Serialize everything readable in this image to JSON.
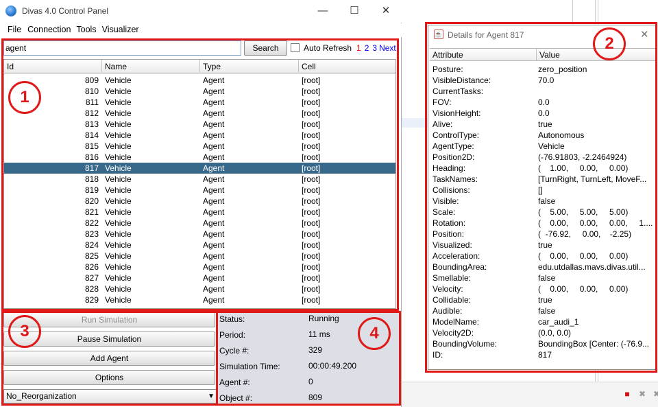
{
  "main_window": {
    "title": "Divas 4.0 Control Panel",
    "controls": {
      "minimize": "—",
      "maximize": "☐",
      "close": "✕"
    }
  },
  "menu": [
    "File",
    "Connection",
    "Tools",
    "Visualizer"
  ],
  "search": {
    "value": "agent",
    "button": "Search",
    "auto_refresh_label": "Auto Refresh",
    "auto_refresh_checked": false
  },
  "pagination": {
    "current": "1",
    "pages": [
      "2",
      "3"
    ],
    "next": "Next"
  },
  "table": {
    "columns": [
      "Id",
      "Name",
      "Type",
      "Cell"
    ],
    "rows": [
      [
        "809",
        "Vehicle",
        "Agent",
        "[root]"
      ],
      [
        "810",
        "Vehicle",
        "Agent",
        "[root]"
      ],
      [
        "811",
        "Vehicle",
        "Agent",
        "[root]"
      ],
      [
        "812",
        "Vehicle",
        "Agent",
        "[root]"
      ],
      [
        "813",
        "Vehicle",
        "Agent",
        "[root]"
      ],
      [
        "814",
        "Vehicle",
        "Agent",
        "[root]"
      ],
      [
        "815",
        "Vehicle",
        "Agent",
        "[root]"
      ],
      [
        "816",
        "Vehicle",
        "Agent",
        "[root]"
      ],
      [
        "817",
        "Vehicle",
        "Agent",
        "[root]"
      ],
      [
        "818",
        "Vehicle",
        "Agent",
        "[root]"
      ],
      [
        "819",
        "Vehicle",
        "Agent",
        "[root]"
      ],
      [
        "820",
        "Vehicle",
        "Agent",
        "[root]"
      ],
      [
        "821",
        "Vehicle",
        "Agent",
        "[root]"
      ],
      [
        "822",
        "Vehicle",
        "Agent",
        "[root]"
      ],
      [
        "823",
        "Vehicle",
        "Agent",
        "[root]"
      ],
      [
        "824",
        "Vehicle",
        "Agent",
        "[root]"
      ],
      [
        "825",
        "Vehicle",
        "Agent",
        "[root]"
      ],
      [
        "826",
        "Vehicle",
        "Agent",
        "[root]"
      ],
      [
        "827",
        "Vehicle",
        "Agent",
        "[root]"
      ],
      [
        "828",
        "Vehicle",
        "Agent",
        "[root]"
      ],
      [
        "829",
        "Vehicle",
        "Agent",
        "[root]"
      ]
    ],
    "selected_id": "817",
    "selected_color": "#39698a"
  },
  "controls": {
    "run": "Run Simulation",
    "pause": "Pause Simulation",
    "add_agent": "Add Agent",
    "options": "Options",
    "reorganization": "No_Reorganization"
  },
  "status": {
    "rows": [
      {
        "label": "Status:",
        "value": "Running"
      },
      {
        "label": "Period:",
        "value": "11 ms"
      },
      {
        "label": "Cycle #:",
        "value": "329"
      },
      {
        "label": "Simulation Time:",
        "value": "00:00:49.200"
      },
      {
        "label": "Agent #:",
        "value": "0"
      },
      {
        "label": "Object #:",
        "value": "809"
      }
    ]
  },
  "details": {
    "title": "Details for Agent 817",
    "columns": [
      "Attribute",
      "Value"
    ],
    "rows": [
      [
        "Posture:",
        "zero_position"
      ],
      [
        "VisibleDistance:",
        "70.0"
      ],
      [
        "CurrentTasks:",
        ""
      ],
      [
        "FOV:",
        "0.0"
      ],
      [
        "VisionHeight:",
        "0.0"
      ],
      [
        "Alive:",
        "true"
      ],
      [
        "ControlType:",
        "Autonomous"
      ],
      [
        "AgentType:",
        "Vehicle"
      ],
      [
        "Position2D:",
        "(-76.91803, -2.2464924)"
      ],
      [
        "Heading:",
        "(    1.00,     0.00,     0.00)"
      ],
      [
        "TaskNames:",
        "[TurnRight, TurnLeft, MoveF..."
      ],
      [
        "Collisions:",
        "[]"
      ],
      [
        "Visible:",
        "false"
      ],
      [
        "Scale:",
        "(    5.00,     5.00,     5.00)"
      ],
      [
        "Rotation:",
        "(    0.00,     0.00,     0.00,     1...."
      ],
      [
        "Position:",
        "(  -76.92,     0.00,    -2.25)"
      ],
      [
        "Visualized:",
        "true"
      ],
      [
        "Acceleration:",
        "(    0.00,     0.00,     0.00)"
      ],
      [
        "BoundingArea:",
        "edu.utdallas.mavs.divas.util..."
      ],
      [
        "Smellable:",
        "false"
      ],
      [
        "Velocity:",
        "(    0.00,     0.00,     0.00)"
      ],
      [
        "Collidable:",
        "true"
      ],
      [
        "Audible:",
        "false"
      ],
      [
        "ModelName:",
        "car_audi_1"
      ],
      [
        "Velocity2D:",
        "(0.0, 0.0)"
      ],
      [
        "BoundingVolume:",
        "BoundingBox [Center: (-76.9..."
      ],
      [
        "ID:",
        "817"
      ]
    ]
  },
  "annotations": {
    "color": "#e01919",
    "labels": [
      "1",
      "2",
      "3",
      "4"
    ]
  }
}
